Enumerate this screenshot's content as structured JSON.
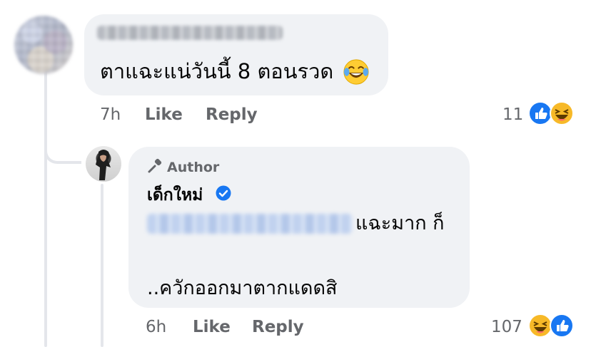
{
  "comment": {
    "author_name_redacted": "",
    "text": "ตาแฉะแน่วันนี้ 8 ตอนรวด",
    "emoji": "face-with-tears-of-joy",
    "time": "7h",
    "like_label": "Like",
    "reply_label": "Reply",
    "reaction_count": "11",
    "reactions": [
      "like",
      "haha"
    ]
  },
  "reply": {
    "badge_label": "Author",
    "author_name": "เด็กใหม่",
    "verified": true,
    "text_line1": "แฉะมาก ก็",
    "text_line2": "..ควักออกมาตากแดดสิ",
    "time": "6h",
    "like_label": "Like",
    "reply_label": "Reply",
    "reaction_count": "107",
    "reactions": [
      "haha",
      "like"
    ]
  },
  "colors": {
    "bubble": "#f0f2f5",
    "meta_text": "#65676b",
    "like_blue": "#1877f2",
    "haha_yellow": "#f7b928"
  }
}
